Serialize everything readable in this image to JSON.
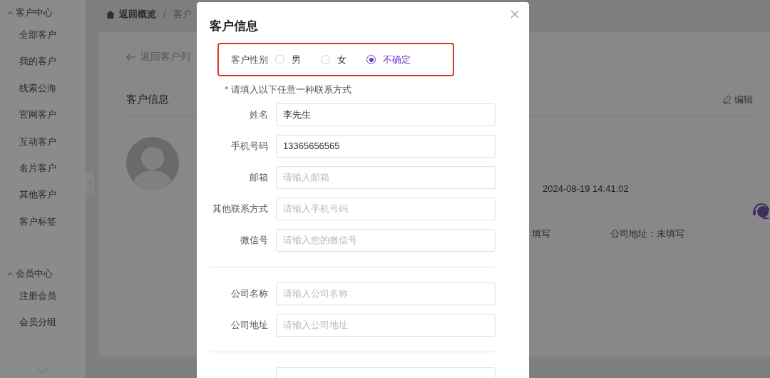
{
  "sidebar": {
    "groups": [
      {
        "title": "客户中心",
        "expanded": true,
        "items": [
          "全部客户",
          "我的客户",
          "线索公海",
          "官网客户",
          "互动客户",
          "名片客户",
          "其他客户",
          "客户标签"
        ]
      },
      {
        "title": "会员中心",
        "expanded": true,
        "items": [
          "注册会员",
          "会员分组"
        ]
      }
    ]
  },
  "breadcrumb": [
    "返回概览",
    "/",
    "客户"
  ],
  "page": {
    "back_link": "返回客户列",
    "section_title": "客户信息",
    "edit_button": "编辑",
    "fields": [
      {
        "value": "2024-08-19 14:41:02"
      },
      {
        "value": "填写"
      },
      {
        "label": "公司地址：",
        "value": "未填写"
      }
    ]
  },
  "modal": {
    "title": "客户信息",
    "gender": {
      "label": "客户性别",
      "options": [
        {
          "label": "男",
          "selected": false
        },
        {
          "label": "女",
          "selected": false
        },
        {
          "label": "不确定",
          "selected": true
        }
      ]
    },
    "notice": {
      "mark": "*",
      "text": "请填入以下任意一种联系方式"
    },
    "groups": [
      [
        {
          "kind": "input",
          "label": "姓名",
          "value": "李先生"
        },
        {
          "kind": "input",
          "label": "手机号码",
          "value": "13365656565"
        },
        {
          "kind": "input",
          "label": "邮箱",
          "placeholder": "请输入邮箱"
        },
        {
          "kind": "input",
          "label": "其他联系方式",
          "placeholder": "请输入手机号码"
        },
        {
          "kind": "input",
          "label": "微信号",
          "placeholder": "请输入您的微信号"
        }
      ],
      [
        {
          "kind": "input",
          "label": "公司名称",
          "placeholder": "请输入公司名称"
        },
        {
          "kind": "input",
          "label": "公司地址",
          "placeholder": "请输入公司地址"
        }
      ],
      [
        {
          "kind": "input"
        }
      ]
    ]
  }
}
